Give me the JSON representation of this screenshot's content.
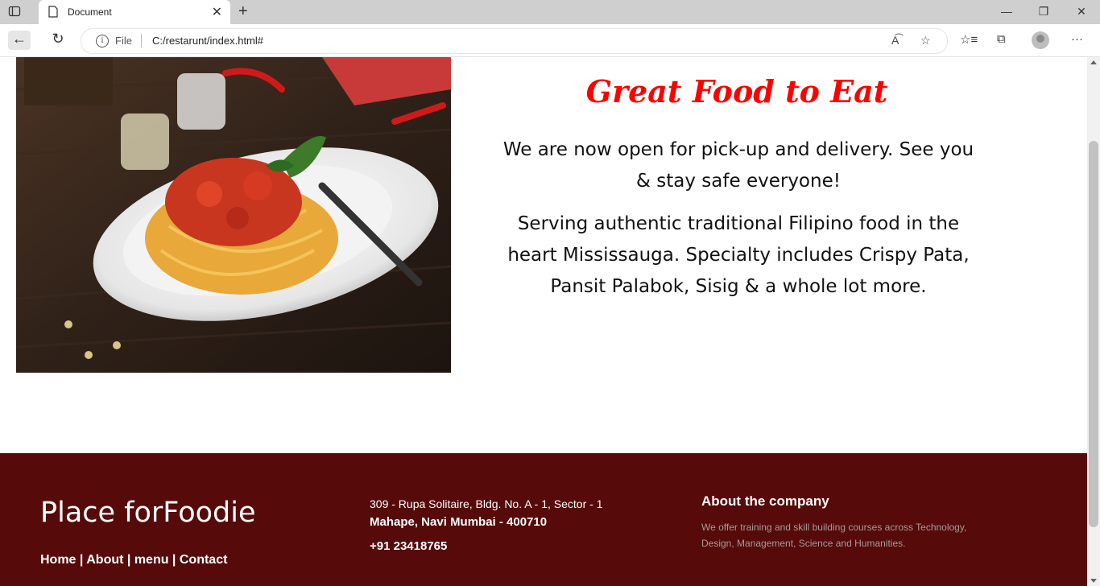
{
  "browser": {
    "tab_title": "Document",
    "address_scheme": "File",
    "url": "C:/restarunt/index.html#"
  },
  "hero": {
    "headline": "Great Food to Eat",
    "paragraph1": "We are now open for pick-up and delivery. See you & stay safe everyone!",
    "paragraph2": "Serving authentic traditional Filipino food in the heart Mississauga. Specialty includes Crispy Pata, Pansit Palabok, Sisig & a whole lot more."
  },
  "footer": {
    "brand": "Place forFoodie",
    "nav": [
      "Home",
      "About",
      "menu",
      "Contact"
    ],
    "separator": " | ",
    "address_line1": "309 - Rupa Solitaire, Bldg. No. A - 1, Sector - 1",
    "address_line2": "Mahape, Navi Mumbai - 400710",
    "phone": "+91 23418765",
    "about_heading": "About the company",
    "about_text": "We offer training and skill building courses across Technology, Design, Management, Science and Humanities."
  },
  "colors": {
    "headline": "#ff0000",
    "footer_bg": "#560a0a"
  }
}
